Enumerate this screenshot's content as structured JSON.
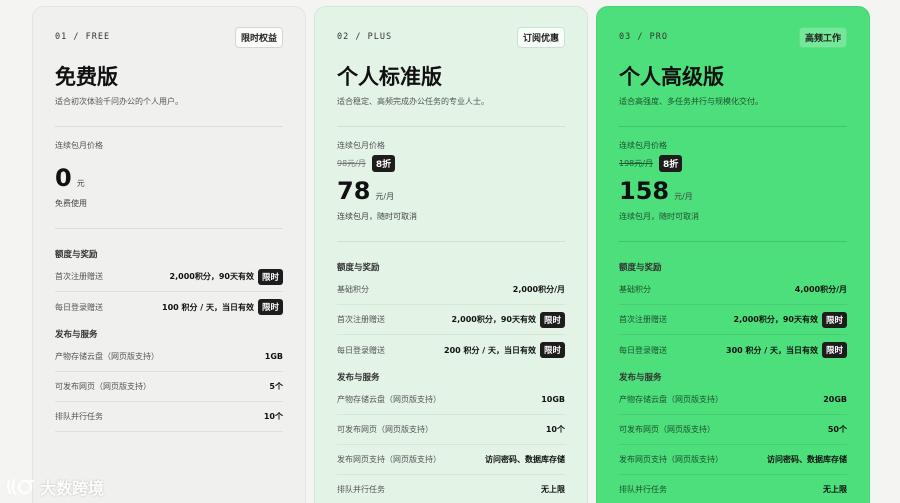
{
  "plans": [
    {
      "code": "01 / FREE",
      "tag": "限时权益",
      "title": "免费版",
      "subtitle": "适合初次体验千问办公的个人用户。",
      "price_label": "连续包月价格",
      "amount": "0",
      "unit": "元",
      "note": "免费使用",
      "quota_title": "额度与奖励",
      "quota": [
        {
          "k": "首次注册赠送",
          "v": "2,000积分，90天有效",
          "limited": "限时"
        },
        {
          "k": "每日登录赠送",
          "v": "100 积分 / 天，当日有效",
          "limited": "限时"
        }
      ],
      "service_title": "发布与服务",
      "service": [
        {
          "k": "产物存储云盘（网页版支持）",
          "v": "1GB"
        },
        {
          "k": "可发布网页（网页版支持）",
          "v": "5个"
        },
        {
          "k": "排队并行任务",
          "v": "10个"
        }
      ]
    },
    {
      "code": "02 / PLUS",
      "tag": "订阅优惠",
      "title": "个人标准版",
      "subtitle": "适合稳定、高频完成办公任务的专业人士。",
      "price_label": "连续包月价格",
      "orig": "98元/月",
      "discount": "8折",
      "amount": "78",
      "unit": "元/月",
      "note": "连续包月，随时可取消",
      "quota_title": "额度与奖励",
      "quota": [
        {
          "k": "基础积分",
          "v": "2,000积分/月"
        },
        {
          "k": "首次注册赠送",
          "v": "2,000积分，90天有效",
          "limited": "限时"
        },
        {
          "k": "每日登录赠送",
          "v": "200 积分 / 天，当日有效",
          "limited": "限时"
        }
      ],
      "service_title": "发布与服务",
      "service": [
        {
          "k": "产物存储云盘（网页版支持）",
          "v": "10GB"
        },
        {
          "k": "可发布网页（网页版支持）",
          "v": "10个"
        },
        {
          "k": "发布网页支持（网页版支持）",
          "v": "访问密码、数据库存储"
        },
        {
          "k": "排队并行任务",
          "v": "无上限"
        }
      ]
    },
    {
      "code": "03 / PRO",
      "tag": "高频工作",
      "title": "个人高级版",
      "subtitle": "适合高强度、多任务并行与规模化交付。",
      "price_label": "连续包月价格",
      "orig": "198元/月",
      "discount": "8折",
      "amount": "158",
      "unit": "元/月",
      "note": "连续包月，随时可取消",
      "quota_title": "额度与奖励",
      "quota": [
        {
          "k": "基础积分",
          "v": "4,000积分/月"
        },
        {
          "k": "首次注册赠送",
          "v": "2,000积分，90天有效",
          "limited": "限时"
        },
        {
          "k": "每日登录赠送",
          "v": "300 积分 / 天，当日有效",
          "limited": "限时"
        }
      ],
      "service_title": "发布与服务",
      "service": [
        {
          "k": "产物存储云盘（网页版支持）",
          "v": "20GB"
        },
        {
          "k": "可发布网页（网页版支持）",
          "v": "50个"
        },
        {
          "k": "发布网页支持（网页版支持）",
          "v": "访问密码、数据库存储"
        },
        {
          "k": "排队并行任务",
          "v": "无上限"
        }
      ]
    }
  ],
  "watermark": {
    "text": "大数跨境",
    "icon": "brand-logo-icon"
  },
  "colors": {
    "pro_bg": "#4ddf7b",
    "plus_bg": "#e3f4e7",
    "free_bg": "#f0f0ee",
    "badge": "#1d1d1d"
  }
}
